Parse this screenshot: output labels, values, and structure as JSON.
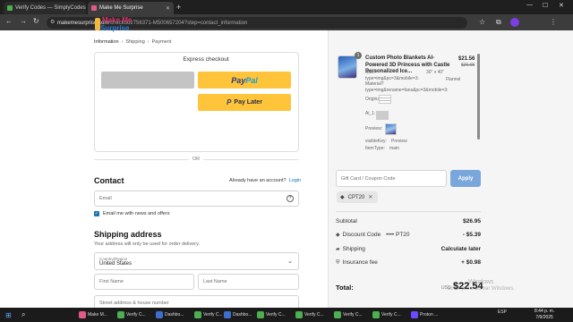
{
  "browser": {
    "tabs": [
      {
        "label": "Verify Codes — SimplyCodes",
        "active": false
      },
      {
        "label": "Make Me Surprise",
        "active": true
      }
    ],
    "url_domain": "makemesurprise.com",
    "url_path": "/checkout/756371-M500657204?step=contact_information"
  },
  "brand": {
    "line1": "Make Me",
    "line2": "Surprise"
  },
  "breadcrumb": {
    "step1": "Information",
    "step2": "Shipping",
    "step3": "Payment"
  },
  "express": {
    "title": "Express checkout",
    "paypal_a": "Pay",
    "paypal_b": "Pal",
    "paylater_prefix": "P",
    "paylater_label": "Pay Later",
    "or": "OR"
  },
  "contact": {
    "heading": "Contact",
    "have_account": "Already have an account?",
    "login": "Login",
    "email_placeholder": "Email",
    "news_label": "Email me with news and offers"
  },
  "shipping": {
    "heading": "Shipping address",
    "note": "Your address will only be used for order delivery.",
    "country_label": "Country/Region",
    "country_value": "United States",
    "first_name": "First Name",
    "last_name": "Last Name",
    "street": "Street address & house number"
  },
  "product": {
    "qty": "1",
    "title": "Custom Photo Blankets AI-Powered 3D Princess with Castle Personalized Ice...",
    "price": "$21.56",
    "compare_price": "$26.95",
    "attr_main": "Size?type=img&pc=3&mobile=3: Material?type=img&rename=fans&pc=3&mobile=3:",
    "attr_size": "30\" x 40\"",
    "attr_material": "Flannel",
    "original_label": "Original_1:",
    "ai_label": "Ai_1:",
    "preview_label": "Preview:",
    "visible_key_label": "visibleKey:",
    "visible_key_value": "Preview",
    "item_type_label": "ItemType:",
    "item_type_value": "main"
  },
  "discount": {
    "placeholder": "Gift Card / Coupon Code",
    "apply": "Apply",
    "applied_code": "CPT20"
  },
  "summary": {
    "subtotal_label": "Subtotal",
    "subtotal": "$26.95",
    "discount_label": "Discount Code",
    "discount_code": "•••• PT20",
    "discount": "- $5.39",
    "shipping_label": "Shipping",
    "shipping": "Calculate later",
    "insurance_label": "Insurance fee",
    "insurance": "+ $0.98",
    "total_label": "Total:",
    "currency": "USD",
    "total": "$22.54"
  },
  "watermark": {
    "line1": "Windows",
    "line2": "ación para activar Windows."
  },
  "taskbar": {
    "items": [
      "Make M...",
      "Verify C...",
      "Dashbo...",
      "Verify C...",
      "Dashbo...",
      "Verify C...",
      "Verify C...",
      "Verify C...",
      "Verify C...",
      "Proton ..."
    ],
    "lang": "ESP",
    "time": "8:44 p. m.",
    "date": "7/9/2025"
  },
  "colors": {
    "accent": "#1773b0",
    "paypal_yellow": "#ffc439",
    "apply_blue": "#79a7db"
  }
}
